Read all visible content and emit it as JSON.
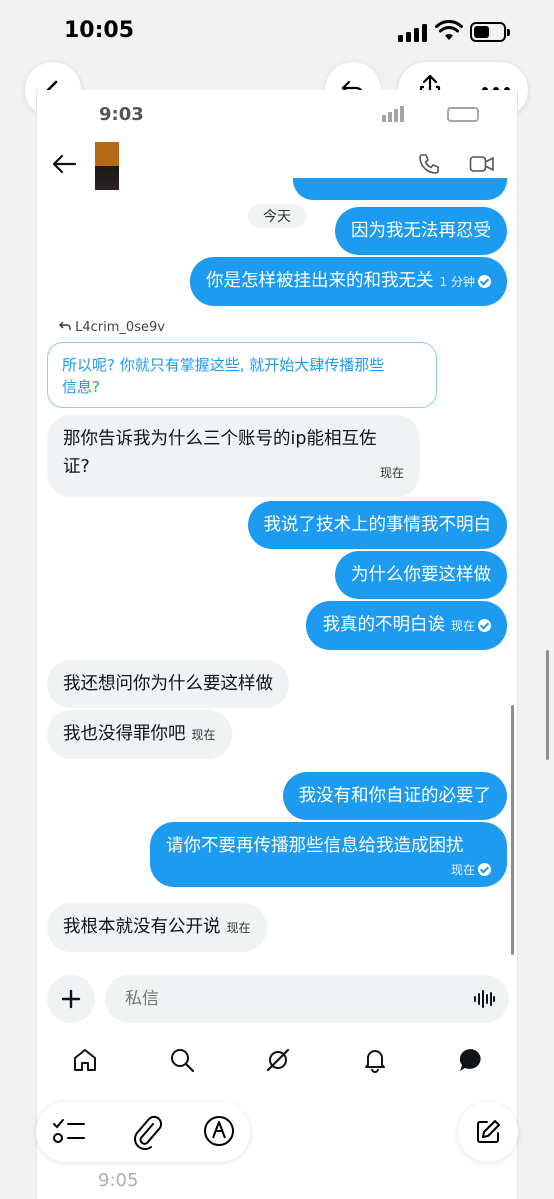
{
  "status_bar": {
    "time": "10:05"
  },
  "viewer": {
    "back": "back-button",
    "reply": "reply-button",
    "share": "share-button",
    "more": "more-button"
  },
  "inner_status": {
    "time": "9:03"
  },
  "chat": {
    "day_label": "今天",
    "messages": [
      {
        "direction": "out",
        "text": "因为我无法再忍受",
        "time": ""
      },
      {
        "direction": "out",
        "text": "你是怎样被挂出来的和我无关",
        "time": "1 分钟"
      },
      {
        "direction": "in",
        "text": "那你告诉我为什么三个账号的ip能相互佐",
        "text2": "证?",
        "time": "现在"
      },
      {
        "direction": "out",
        "text": "我说了技术上的事情我不明白",
        "time": ""
      },
      {
        "direction": "out",
        "text": "为什么你要这样做",
        "time": ""
      },
      {
        "direction": "out",
        "text": "我真的不明白诶",
        "time": "现在"
      },
      {
        "direction": "in",
        "text": "我还想问你为什么要这样做",
        "time": ""
      },
      {
        "direction": "in",
        "text": "我也没得罪你吧",
        "time": "现在"
      },
      {
        "direction": "out",
        "text": "我没有和你自证的必要了",
        "time": ""
      },
      {
        "direction": "out",
        "text": "请你不要再传播那些信息给我造成困扰",
        "time": "现在"
      },
      {
        "direction": "in",
        "text": "我根本就没有公开说",
        "time": "现在"
      }
    ],
    "reply_to": "L4crim_0se9v",
    "quote_line1": "所以呢? 你就只有掌握这些, 就开始大肆传播那些",
    "quote_line2": "信息?"
  },
  "composer": {
    "placeholder": "私信"
  },
  "bottom": {
    "time": "9:05"
  },
  "colors": {
    "accent": "#1d9bf0",
    "incoming": "#eff3f4"
  },
  "icons": [
    "back-icon",
    "reply-icon",
    "share-icon",
    "more-icon",
    "phone-icon",
    "video-icon",
    "plus-icon",
    "voice-icon",
    "home-icon",
    "search-icon",
    "grok-icon",
    "bell-icon",
    "messages-icon",
    "checklist-icon",
    "paperclip-icon",
    "markup-icon",
    "compose-icon"
  ]
}
